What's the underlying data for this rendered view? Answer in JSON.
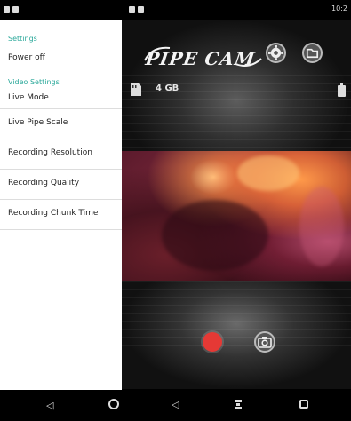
{
  "settings_screen": {
    "section_general": "Settings",
    "item_power_off": "Power off",
    "section_video": "Video Settings",
    "items": [
      "Live Mode",
      "Live Pipe Scale",
      "Recording Resolution",
      "Recording Quality",
      "Recording Chunk Time"
    ]
  },
  "camera_screen": {
    "status_time": "10:2",
    "logo": "PIPE CAM",
    "storage": "4 GB",
    "colors": {
      "record": "#e53935",
      "settings_accent": "#2aa89a"
    },
    "icons": {
      "settings": "gear-icon",
      "folder": "folder-icon",
      "storage": "sd-card-icon",
      "battery": "battery-icon",
      "record": "record-icon",
      "snapshot": "camera-icon"
    }
  },
  "nav": {
    "back": "◁",
    "recent": "□"
  }
}
